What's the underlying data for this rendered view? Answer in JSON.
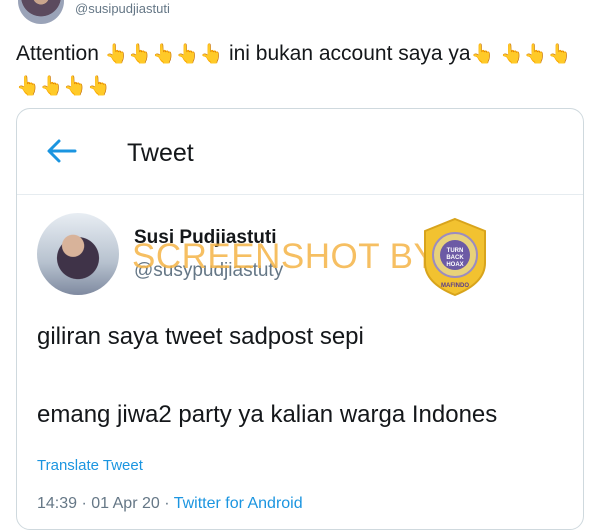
{
  "top": {
    "handle": "@susipudjiastuti"
  },
  "post": {
    "text": "Attention",
    "text_after": "ini bukan account saya ya",
    "emoji": "👆"
  },
  "embedded": {
    "header_title": "Tweet",
    "name": "Susi Pudjiastuti",
    "handle": "@susypudjiastuty",
    "watermark": "SCREENSHOT BY",
    "logo_text": "TURN BACK HOAX",
    "logo_subtext": "MAFINDO",
    "tweet_line1": "giliran saya tweet sadpost sepi",
    "tweet_line2": "emang jiwa2 party ya kalian warga Indones",
    "translate": "Translate Tweet",
    "time": "14:39 · 01 Apr 20 · ",
    "source": "Twitter for Android"
  },
  "colors": {
    "accent": "#1b95e0",
    "muted": "#657786",
    "watermark": "#f5b446"
  }
}
